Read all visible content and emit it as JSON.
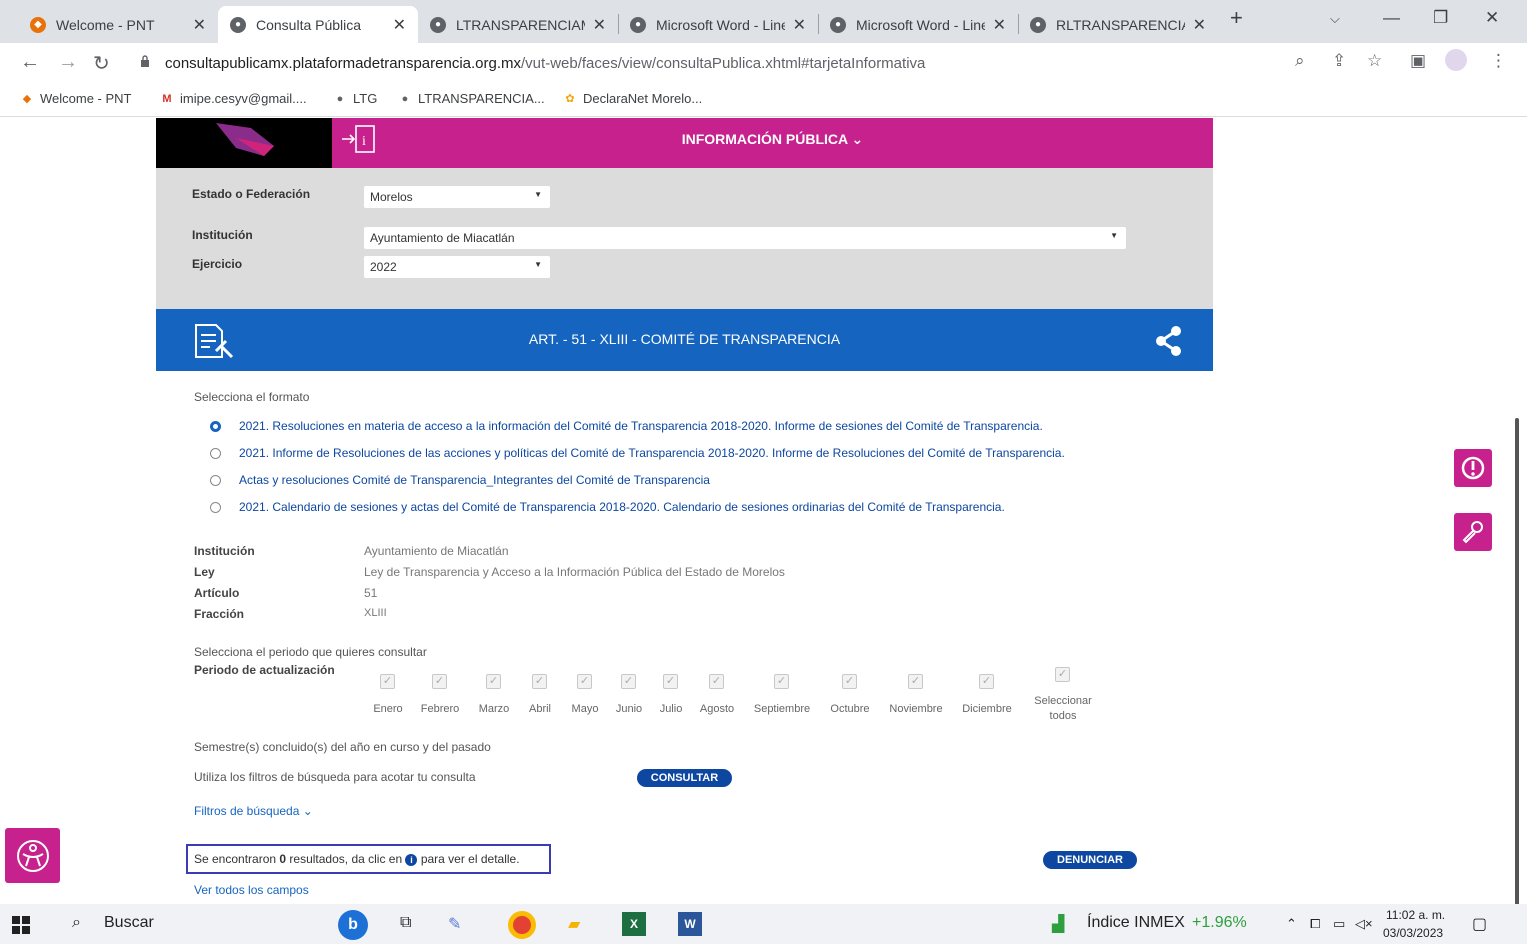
{
  "browser": {
    "tabs": [
      {
        "label": "Welcome - PNT"
      },
      {
        "label": "Consulta Pública"
      },
      {
        "label": "LTRANSPARENCIAMO"
      },
      {
        "label": "Microsoft Word - Line"
      },
      {
        "label": "Microsoft Word - Line"
      },
      {
        "label": "RLTRANSPARENCIAM"
      }
    ],
    "url_host": "consultapublicamx.plataformadetransparencia.org.mx",
    "url_rest": "/vut-web/faces/view/consultaPublica.xhtml#tarjetaInformativa",
    "bookmarks": [
      {
        "label": "Welcome - PNT"
      },
      {
        "label": "imipe.cesyv@gmail...."
      },
      {
        "label": "LTG"
      },
      {
        "label": "LTRANSPARENCIA..."
      },
      {
        "label": "DeclaraNet Morelo..."
      }
    ]
  },
  "header": {
    "title": "INFORMACIÓN PÚBLICA"
  },
  "filters": {
    "estado_label": "Estado o Federación",
    "estado_value": "Morelos",
    "institucion_label": "Institución",
    "institucion_value": "Ayuntamiento de Miacatlán",
    "ejercicio_label": "Ejercicio",
    "ejercicio_value": "2022"
  },
  "section": {
    "title": "ART. - 51 - XLIII - COMITÉ DE TRANSPARENCIA"
  },
  "formats": {
    "prompt": "Selecciona el formato",
    "options": [
      {
        "label": "2021. Resoluciones en materia de acceso a la información del Comité de Transparencia 2018-2020. Informe de sesiones del Comité de Transparencia."
      },
      {
        "label": "2021. Informe de Resoluciones de las acciones y políticas del Comité de Transparencia 2018-2020. Informe de Resoluciones del Comité de Transparencia."
      },
      {
        "label": "Actas y resoluciones Comité de Transparencia_Integrantes del Comité de Transparencia"
      },
      {
        "label": "2021. Calendario de sesiones y actas del Comité de Transparencia 2018-2020. Calendario de sesiones ordinarias del Comité de Transparencia."
      }
    ]
  },
  "info": {
    "institucion_label": "Institución",
    "institucion_value": "Ayuntamiento de Miacatlán",
    "ley_label": "Ley",
    "ley_value": "Ley de Transparencia y Acceso a la Información Pública del Estado de Morelos",
    "articulo_label": "Artículo",
    "articulo_value": "51",
    "fraccion_label": "Fracción",
    "fraccion_value": "XLIII"
  },
  "periodo": {
    "prompt": "Selecciona el periodo que quieres consultar",
    "label": "Periodo de actualización",
    "months": [
      "Enero",
      "Febrero",
      "Marzo",
      "Abril",
      "Mayo",
      "Junio",
      "Julio",
      "Agosto",
      "Septiembre",
      "Octubre",
      "Noviembre",
      "Diciembre"
    ],
    "select_all_1": "Seleccionar",
    "select_all_2": "todos",
    "semestre_text": "Semestre(s) concluido(s) del año en curso y del pasado",
    "filter_hint": "Utiliza los filtros de búsqueda para acotar tu consulta",
    "consultar": "CONSULTAR",
    "filtros_link": "Filtros de búsqueda",
    "results_pre": "Se encontraron ",
    "results_count": "0",
    "results_mid": " resultados, da clic en ",
    "results_post": " para ver el detalle.",
    "denunciar": "DENUNCIAR",
    "ver_todos": "Ver todos los campos"
  },
  "taskbar": {
    "search": "Buscar",
    "index_label": "Índice INMEX",
    "index_change": "+1.96%",
    "time": "11:02 a. m.",
    "date": "03/03/2023"
  },
  "colors": {
    "brand_pink": "#c6218d",
    "brand_blue": "#1565c0",
    "highlight_box": "#3b3bb3"
  }
}
